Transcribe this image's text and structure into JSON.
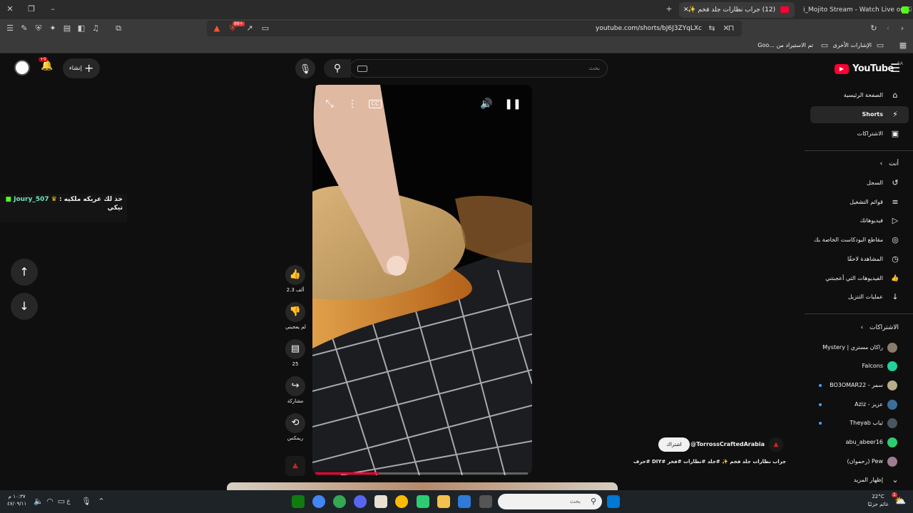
{
  "browser": {
    "tabs": [
      {
        "title": "(12) جراب نظارات جلد فخم ✨",
        "active": true
      },
      {
        "title": "i_Mojito Stream - Watch Live on Kick",
        "active": false
      }
    ],
    "new_tab": "+",
    "url": "youtube.com/shorts/bJ6J3ZYqLXc",
    "badge_count": "99+",
    "bookmarks": {
      "other": "الإشارات الأخرى",
      "imported": "تم الاستيراد من ...Goo"
    }
  },
  "header": {
    "logo": "YouTube",
    "country": "SA",
    "search_placeholder": "بحث",
    "create_label": "إنشاء",
    "notif_badge": "+9"
  },
  "sidebar": {
    "main": [
      {
        "label": "الصفحة الرئيسية",
        "icon": "home-icon",
        "glyph": "⌂"
      },
      {
        "label": "Shorts",
        "icon": "shorts-icon",
        "glyph": "⚡",
        "active": true
      },
      {
        "label": "الاشتراكات",
        "icon": "subscriptions-icon",
        "glyph": "▣"
      }
    ],
    "you_header": "أنت",
    "you": [
      {
        "label": "السجل",
        "icon": "history-icon",
        "glyph": "↺"
      },
      {
        "label": "قوائم التشغيل",
        "icon": "playlists-icon",
        "glyph": "≡"
      },
      {
        "label": "فيديوهاتك",
        "icon": "your-videos-icon",
        "glyph": "▷"
      },
      {
        "label": "مقاطع البودكاست الخاصة بك",
        "icon": "podcasts-icon",
        "glyph": "◎"
      },
      {
        "label": "المشاهدة لاحقًا",
        "icon": "watch-later-icon",
        "glyph": "◷"
      },
      {
        "label": "الفيديوهات التي أعجبتني",
        "icon": "liked-icon",
        "glyph": "👍"
      },
      {
        "label": "عمليات التنزيل",
        "icon": "downloads-icon",
        "glyph": "↓"
      }
    ],
    "subs_header": "الاشتراكات",
    "subs": [
      {
        "label": "راكان مستري | Mystery",
        "color": "#8a7a6a",
        "dot": false
      },
      {
        "label": "Falcons",
        "color": "#1fd39a",
        "dot": false
      },
      {
        "label": "سمر - BO3OMAR22",
        "color": "#b8ad8a",
        "dot": true
      },
      {
        "label": "عزيز - Aziz",
        "color": "#3c6e9a",
        "dot": true
      },
      {
        "label": "ثياب Theyab",
        "color": "#4a5560",
        "dot": true
      },
      {
        "label": "abu_abeer16",
        "color": "#2ecc71",
        "dot": false
      },
      {
        "label": "Pew (رحموان)",
        "color": "#a07a90",
        "dot": false
      }
    ],
    "show_more": "إظهار المزيد"
  },
  "actions": {
    "likes": "2.3 ألف",
    "dislike": "لم يعجبني",
    "comments": "25",
    "share": "مشاركة",
    "remix": "ريمكس"
  },
  "video": {
    "channel": "@TorrossCraftedArabia",
    "subscribe": "اشتراك",
    "title": "جراب نظارات جلد فخم ✨ #جلد #نظارات #فخر #DIY #حرف",
    "progress": 0.3
  },
  "chat_overlay": {
    "user": "Joury_507",
    "message": "خذ لك عريكه ملكيه :",
    "line2": "تيكي"
  },
  "taskbar": {
    "search_placeholder": "بحث",
    "weather_temp": "22°C",
    "weather_desc": "غائم جزئيًا",
    "time": "١٠:٣٧ م",
    "date": "٤٧/٠٩/١١",
    "lang": "ع",
    "weather_badge": "1"
  }
}
